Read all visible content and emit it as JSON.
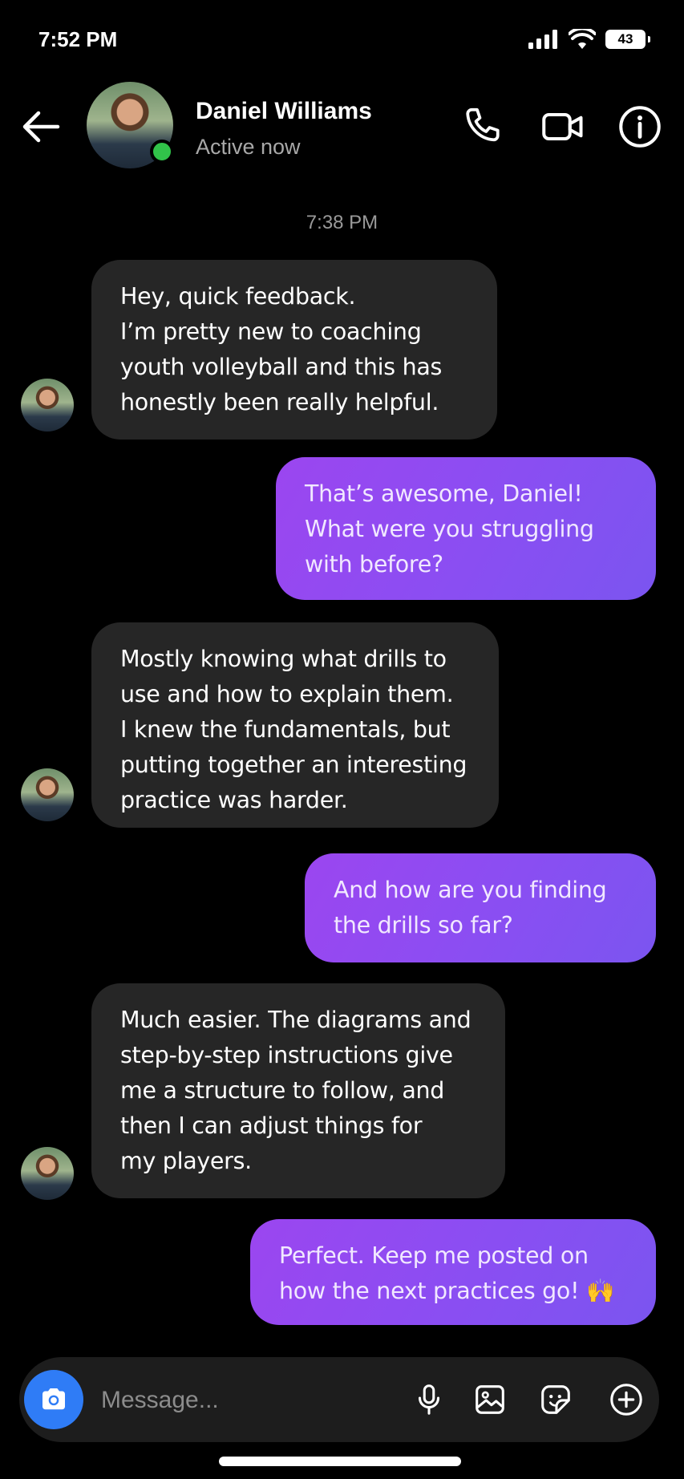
{
  "status_bar": {
    "time": "7:52 PM",
    "battery": "43"
  },
  "header": {
    "name": "Daniel Williams",
    "status": "Active now"
  },
  "conversation": {
    "timestamp": "7:38 PM",
    "messages": [
      {
        "from": "them",
        "lines": [
          "Hey, quick feedback.",
          "I’m pretty new to coaching",
          "youth volleyball and this has",
          "honestly been really helpful."
        ]
      },
      {
        "from": "me",
        "lines": [
          "That’s awesome, Daniel!",
          "What were you struggling",
          "with before?"
        ]
      },
      {
        "from": "them",
        "lines": [
          "Mostly knowing what drills to",
          "use and how to explain them.",
          "I knew the fundamentals, but",
          "putting together an interesting",
          "practice was harder."
        ]
      },
      {
        "from": "me",
        "lines": [
          "And how are you finding",
          "the drills so far?"
        ]
      },
      {
        "from": "them",
        "lines": [
          "Much easier. The diagrams and",
          "step-by-step instructions give",
          "me a structure to follow, and",
          "then I can adjust things for",
          "my players."
        ]
      },
      {
        "from": "me",
        "lines": [
          "Perfect. Keep me posted on",
          "how the next practices go! 🙌"
        ]
      }
    ]
  },
  "composer": {
    "placeholder": "Message..."
  },
  "icons": {
    "back": "arrow-left-icon",
    "call": "phone-icon",
    "video": "video-camera-icon",
    "info": "info-icon",
    "camera": "camera-icon",
    "mic": "microphone-icon",
    "gallery": "image-icon",
    "sticker": "sticker-icon",
    "more": "plus-circle-icon"
  },
  "colors": {
    "incoming_bubble": "#262626",
    "outgoing_gradient_start": "#9b46f0",
    "outgoing_gradient_end": "#7b55f0",
    "presence": "#31c34a",
    "camera_button": "#2f7cf6"
  }
}
